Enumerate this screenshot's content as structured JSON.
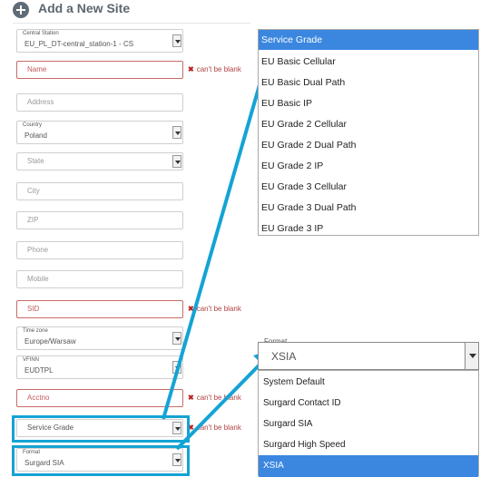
{
  "header": {
    "title": "Add a New Site"
  },
  "form": {
    "central_station": {
      "label": "Central Station",
      "value": "EU_PL_DT-central_station-1 - CS"
    },
    "name": {
      "placeholder": "Name",
      "error": "can't be blank"
    },
    "address": {
      "placeholder": "Address"
    },
    "country": {
      "label": "Country",
      "value": "Poland"
    },
    "state": {
      "placeholder": "State"
    },
    "city": {
      "placeholder": "City"
    },
    "zip": {
      "placeholder": "ZIP"
    },
    "phone": {
      "placeholder": "Phone"
    },
    "mobile": {
      "placeholder": "Mobile"
    },
    "sid": {
      "placeholder": "SID",
      "error": "can't be blank"
    },
    "timezone": {
      "label": "Time zone",
      "value": "Europe/Warsaw"
    },
    "vfinn": {
      "label": "VFINN",
      "value": "EUDTPL"
    },
    "acctno": {
      "placeholder": "Acctno",
      "error": "can't be blank"
    },
    "service_grade": {
      "value": "Service Grade",
      "error": "can't be blank"
    },
    "format": {
      "label": "Format",
      "value": "Surgard SIA"
    }
  },
  "service_grade_dropdown": {
    "selected": "Service Grade",
    "options": [
      "EU Basic Cellular",
      "EU Basic Dual Path",
      "EU Basic IP",
      "EU Grade 2 Cellular",
      "EU Grade 2 Dual Path",
      "EU Grade 2 IP",
      "EU Grade 3 Cellular",
      "EU Grade 3 Dual Path",
      "EU Grade 3 IP"
    ]
  },
  "format_dropdown": {
    "label": "Format",
    "value": "XSIA",
    "options": [
      "System Default",
      "Surgard Contact ID",
      "Surgard SIA",
      "Surgard High Speed"
    ],
    "selected": "XSIA"
  },
  "colors": {
    "highlight": "#14a3d5",
    "selection": "#3b87e0",
    "error": "#b04444"
  }
}
